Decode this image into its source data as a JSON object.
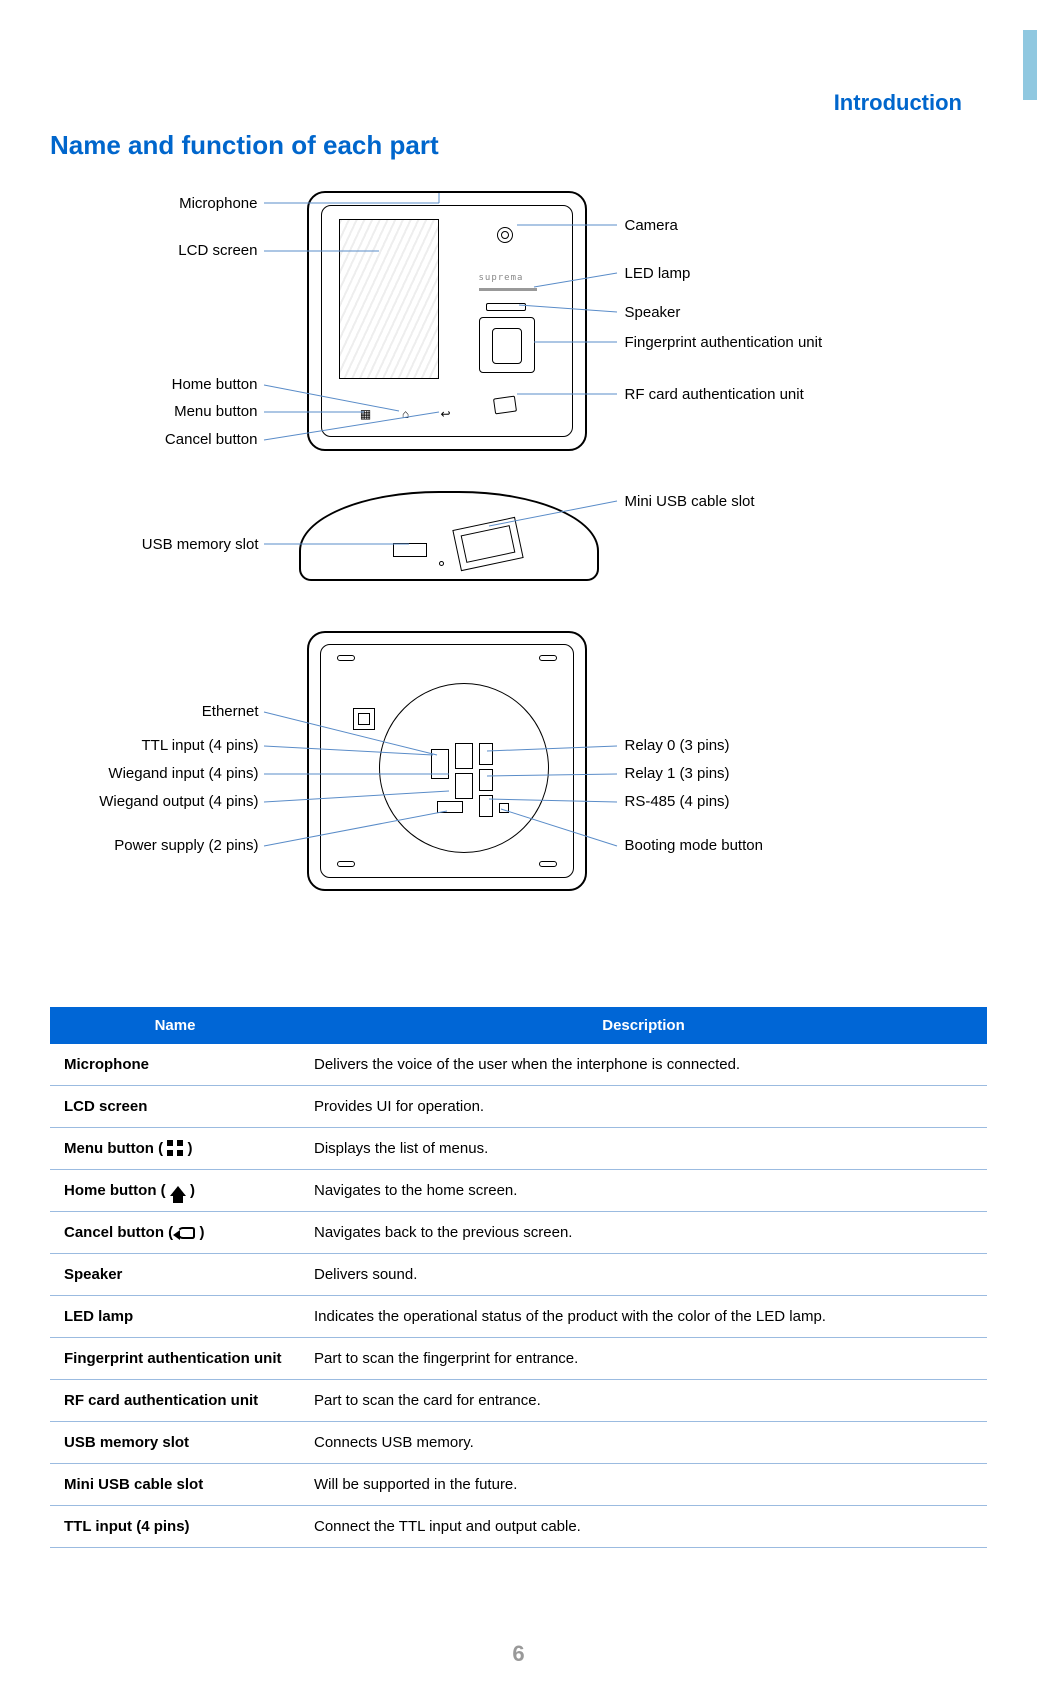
{
  "header": {
    "chapter": "Introduction"
  },
  "section_title": "Name and function of each part",
  "diagram": {
    "brand": "suprema",
    "left_front": {
      "microphone": "Microphone",
      "lcd": "LCD screen",
      "home": "Home button",
      "menu": "Menu button",
      "cancel": "Cancel button"
    },
    "right_front": {
      "camera": "Camera",
      "led": "LED lamp",
      "speaker": "Speaker",
      "fingerprint": "Fingerprint authentication unit",
      "rf": "RF card authentication unit"
    },
    "bottom": {
      "usb_memory": "USB memory slot",
      "mini_usb": "Mini USB cable slot"
    },
    "back_left": {
      "ethernet": "Ethernet",
      "ttl_input": "TTL input (4 pins)",
      "wiegand_in": "Wiegand input (4 pins)",
      "wiegand_out": "Wiegand output (4 pins)",
      "power": "Power supply (2 pins)"
    },
    "back_right": {
      "relay0": "Relay 0 (3 pins)",
      "relay1": "Relay 1 (3 pins)",
      "rs485": "RS-485 (4 pins)",
      "booting": "Booting mode button"
    }
  },
  "table": {
    "headers": {
      "name": "Name",
      "description": "Description"
    },
    "rows": [
      {
        "name": "Microphone",
        "icon": "",
        "desc": "Delivers the voice of the user when the interphone is connected."
      },
      {
        "name": "LCD screen",
        "icon": "",
        "desc": "Provides UI for operation."
      },
      {
        "name": "Menu button (",
        "icon": "menu",
        "name_suffix": " )",
        "desc": "Displays the list of menus."
      },
      {
        "name": "Home button (",
        "icon": "home",
        "name_suffix": " )",
        "desc": "Navigates to the home screen."
      },
      {
        "name": "Cancel button (",
        "icon": "cancel",
        "name_suffix": " )",
        "desc": "Navigates back to the previous screen."
      },
      {
        "name": "Speaker",
        "icon": "",
        "desc": "Delivers sound."
      },
      {
        "name": "LED lamp",
        "icon": "",
        "desc": "Indicates the operational status of the product with the color of the LED lamp."
      },
      {
        "name": "Fingerprint authentication unit",
        "icon": "",
        "desc": "Part to scan the fingerprint for entrance."
      },
      {
        "name": "RF card authentication unit",
        "icon": "",
        "desc": "Part to scan the card for entrance."
      },
      {
        "name": "USB memory slot",
        "icon": "",
        "desc": "Connects USB memory."
      },
      {
        "name": "Mini USB cable slot",
        "icon": "",
        "desc": "Will be supported in the future."
      },
      {
        "name": "TTL input (4 pins)",
        "icon": "",
        "desc": "Connect the TTL input and output cable."
      }
    ]
  },
  "page_number": "6"
}
